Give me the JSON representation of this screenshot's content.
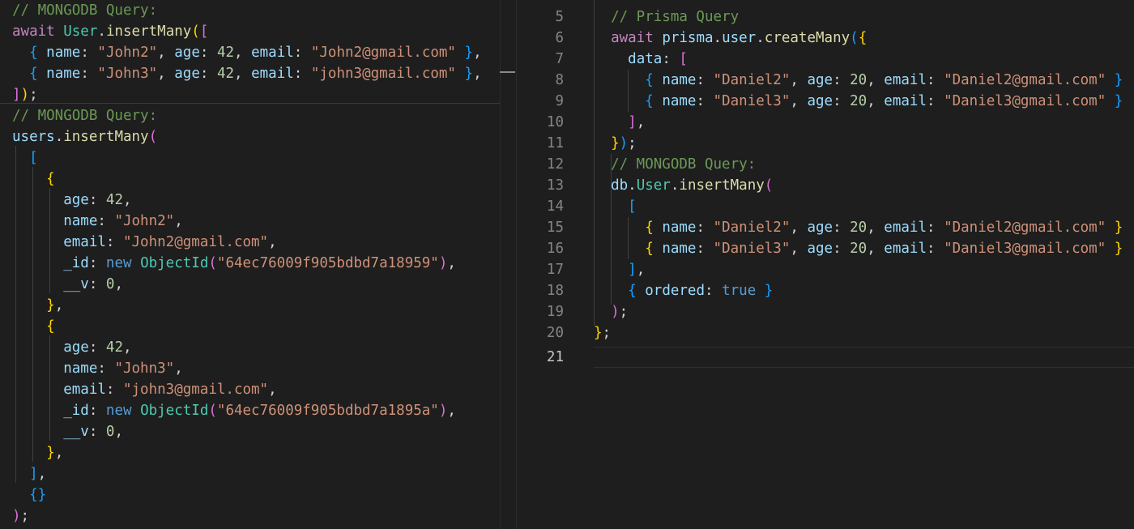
{
  "left_pane": {
    "top_snippet": {
      "comment": "// MONGODB Query:",
      "await_kw": "await",
      "model": "User",
      "method": "insertMany",
      "rows": [
        {
          "name": "\"John2\"",
          "age": "42",
          "email": "\"John2@gmail.com\""
        },
        {
          "name": "\"John3\"",
          "age": "42",
          "email": "\"john3@gmail.com\""
        }
      ],
      "close": "]);"
    },
    "result_snippet": {
      "comment": "// MONGODB Query:",
      "collection": "users",
      "method": "insertMany",
      "docs": [
        {
          "age": "42",
          "name": "\"John2\"",
          "email": "\"John2@gmail.com\"",
          "id": "\"64ec76009f905bdbd7a18959\"",
          "v": "0"
        },
        {
          "age": "42",
          "name": "\"John3\"",
          "email": "\"john3@gmail.com\"",
          "id": "\"64ec76009f905bdbd7a1895a\"",
          "v": "0"
        }
      ],
      "new_kw": "new",
      "objectid": "ObjectId",
      "empty_obj": "{}"
    }
  },
  "right_pane": {
    "line_numbers": [
      "5",
      "6",
      "7",
      "8",
      "9",
      "10",
      "11",
      "12",
      "13",
      "14",
      "15",
      "16",
      "17",
      "18",
      "19",
      "20",
      "21"
    ],
    "active_line": "21",
    "prisma_comment": "// Prisma Query",
    "await_kw": "await",
    "prisma_obj": "prisma",
    "user_prop": "user",
    "create_many": "createMany",
    "data_key": "data",
    "prisma_rows": [
      {
        "name": "\"Daniel2\"",
        "age": "20",
        "email": "\"Daniel2@gmail.com\""
      },
      {
        "name": "\"Daniel3\"",
        "age": "20",
        "email": "\"Daniel3@gmail.com\""
      }
    ],
    "mongo_comment": "// MONGODB Query:",
    "db_obj": "db",
    "user_model": "User",
    "insert_many": "insertMany",
    "mongo_rows": [
      {
        "name": "\"Daniel2\"",
        "age": "20",
        "email": "\"Daniel2@gmail.com\""
      },
      {
        "name": "\"Daniel3\"",
        "age": "20",
        "email": "\"Daniel3@gmail.com\""
      }
    ],
    "ordered_key": "ordered",
    "ordered_val": "true"
  },
  "colors": {
    "background": "#1e1e1e",
    "comment": "#6a9955",
    "keyword": "#569cd6",
    "property": "#9cdcfe",
    "class": "#4ec9b0",
    "function": "#dcdcaa",
    "string": "#ce9178",
    "number": "#b5cea8",
    "bracket_gold": "#ffd700",
    "bracket_purple": "#da70d6",
    "bracket_blue": "#179fff"
  }
}
